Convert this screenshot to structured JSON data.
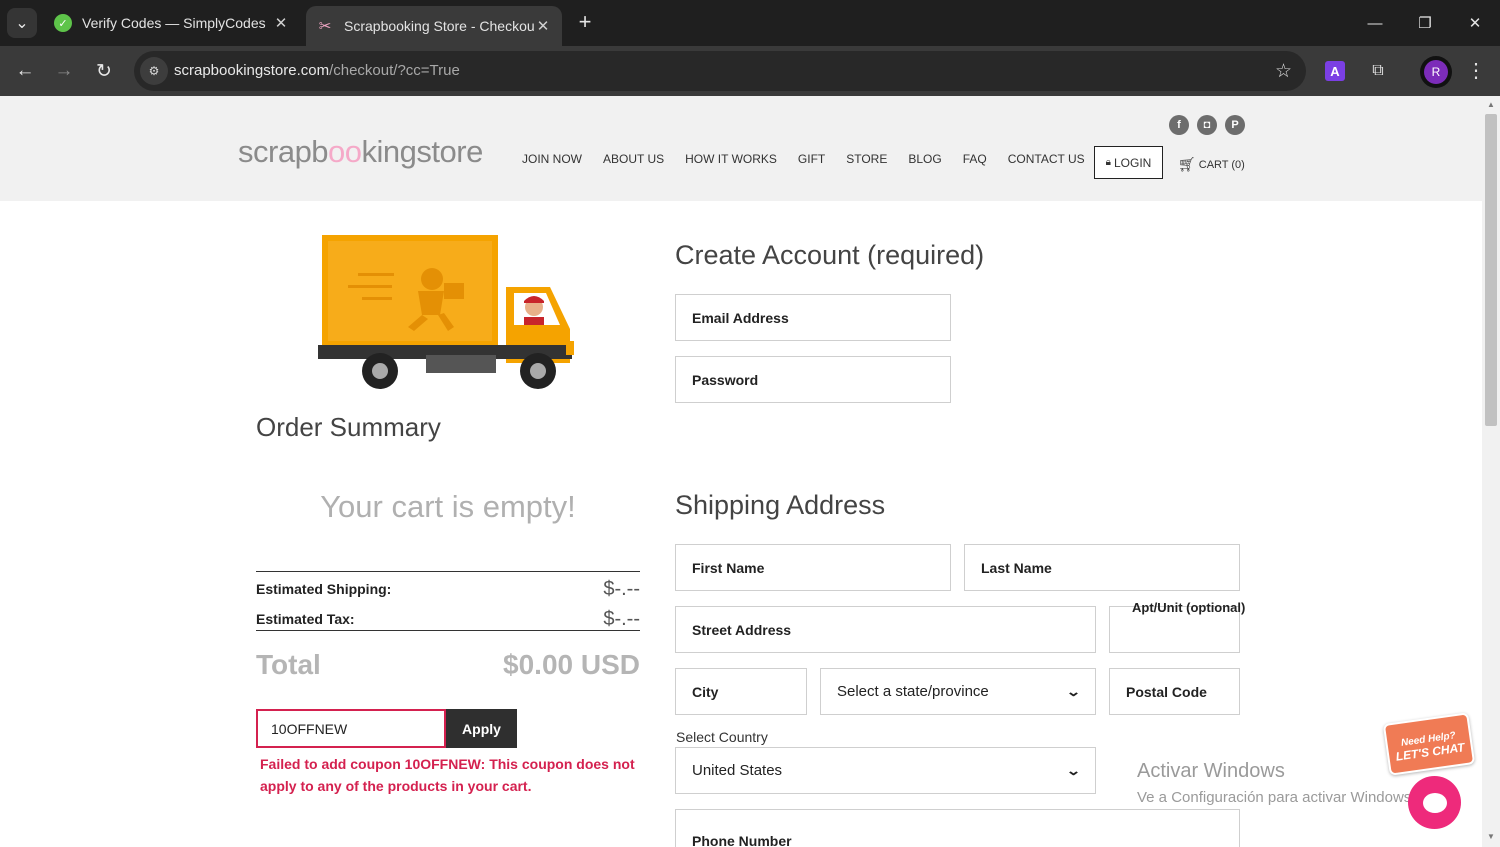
{
  "browser": {
    "tabs": [
      {
        "title": "Verify Codes — SimplyCodes",
        "icon": "simplycodes-favicon"
      },
      {
        "title": "Scrapbooking Store - Checkout",
        "icon": "scrapbooking-favicon"
      }
    ],
    "url_host": "scrapbookingstore.com",
    "url_path": "/checkout/?cc=True",
    "profile_initial": "R",
    "extension_label": "A"
  },
  "header": {
    "logo_prefix": "scrapb",
    "logo_accent": "oo",
    "logo_suffix": "kingstore",
    "nav": [
      "JOIN NOW",
      "ABOUT US",
      "HOW IT WORKS",
      "GIFT",
      "STORE",
      "BLOG",
      "FAQ",
      "CONTACT US"
    ],
    "social": [
      {
        "name": "facebook-icon",
        "glyph": "f"
      },
      {
        "name": "instagram-icon",
        "glyph": "◘"
      },
      {
        "name": "pinterest-icon",
        "glyph": "P"
      }
    ],
    "login_label": "LOGIN",
    "cart_label": "CART (0)"
  },
  "order": {
    "title": "Order Summary",
    "empty_message": "Your cart is empty!",
    "shipping_label": "Estimated Shipping:",
    "shipping_value": "$-.--",
    "tax_label": "Estimated Tax:",
    "tax_value": "$-.--",
    "total_label": "Total",
    "total_value": "$0.00 USD",
    "coupon_value": "10OFFNEW",
    "apply_label": "Apply",
    "coupon_error": "Failed to add coupon 10OFFNEW: This coupon does not apply to any of the products in your cart."
  },
  "account": {
    "title": "Create Account (required)",
    "email_label": "Email Address",
    "password_label": "Password"
  },
  "shipping": {
    "title": "Shipping Address",
    "first_name": "First Name",
    "last_name": "Last Name",
    "street": "Street Address",
    "apt_label": "Apt/Unit (optional)",
    "city": "City",
    "state_placeholder": "Select a state/province",
    "postal": "Postal Code",
    "country_label": "Select Country",
    "country_value": "United States",
    "phone": "Phone Number"
  },
  "overlay": {
    "windows_line1": "Activar Windows",
    "windows_line2": "Ve a Configuración para activar Windows.",
    "chat_sign_line1": "Need Help?",
    "chat_sign_line2": "LET'S CHAT"
  }
}
